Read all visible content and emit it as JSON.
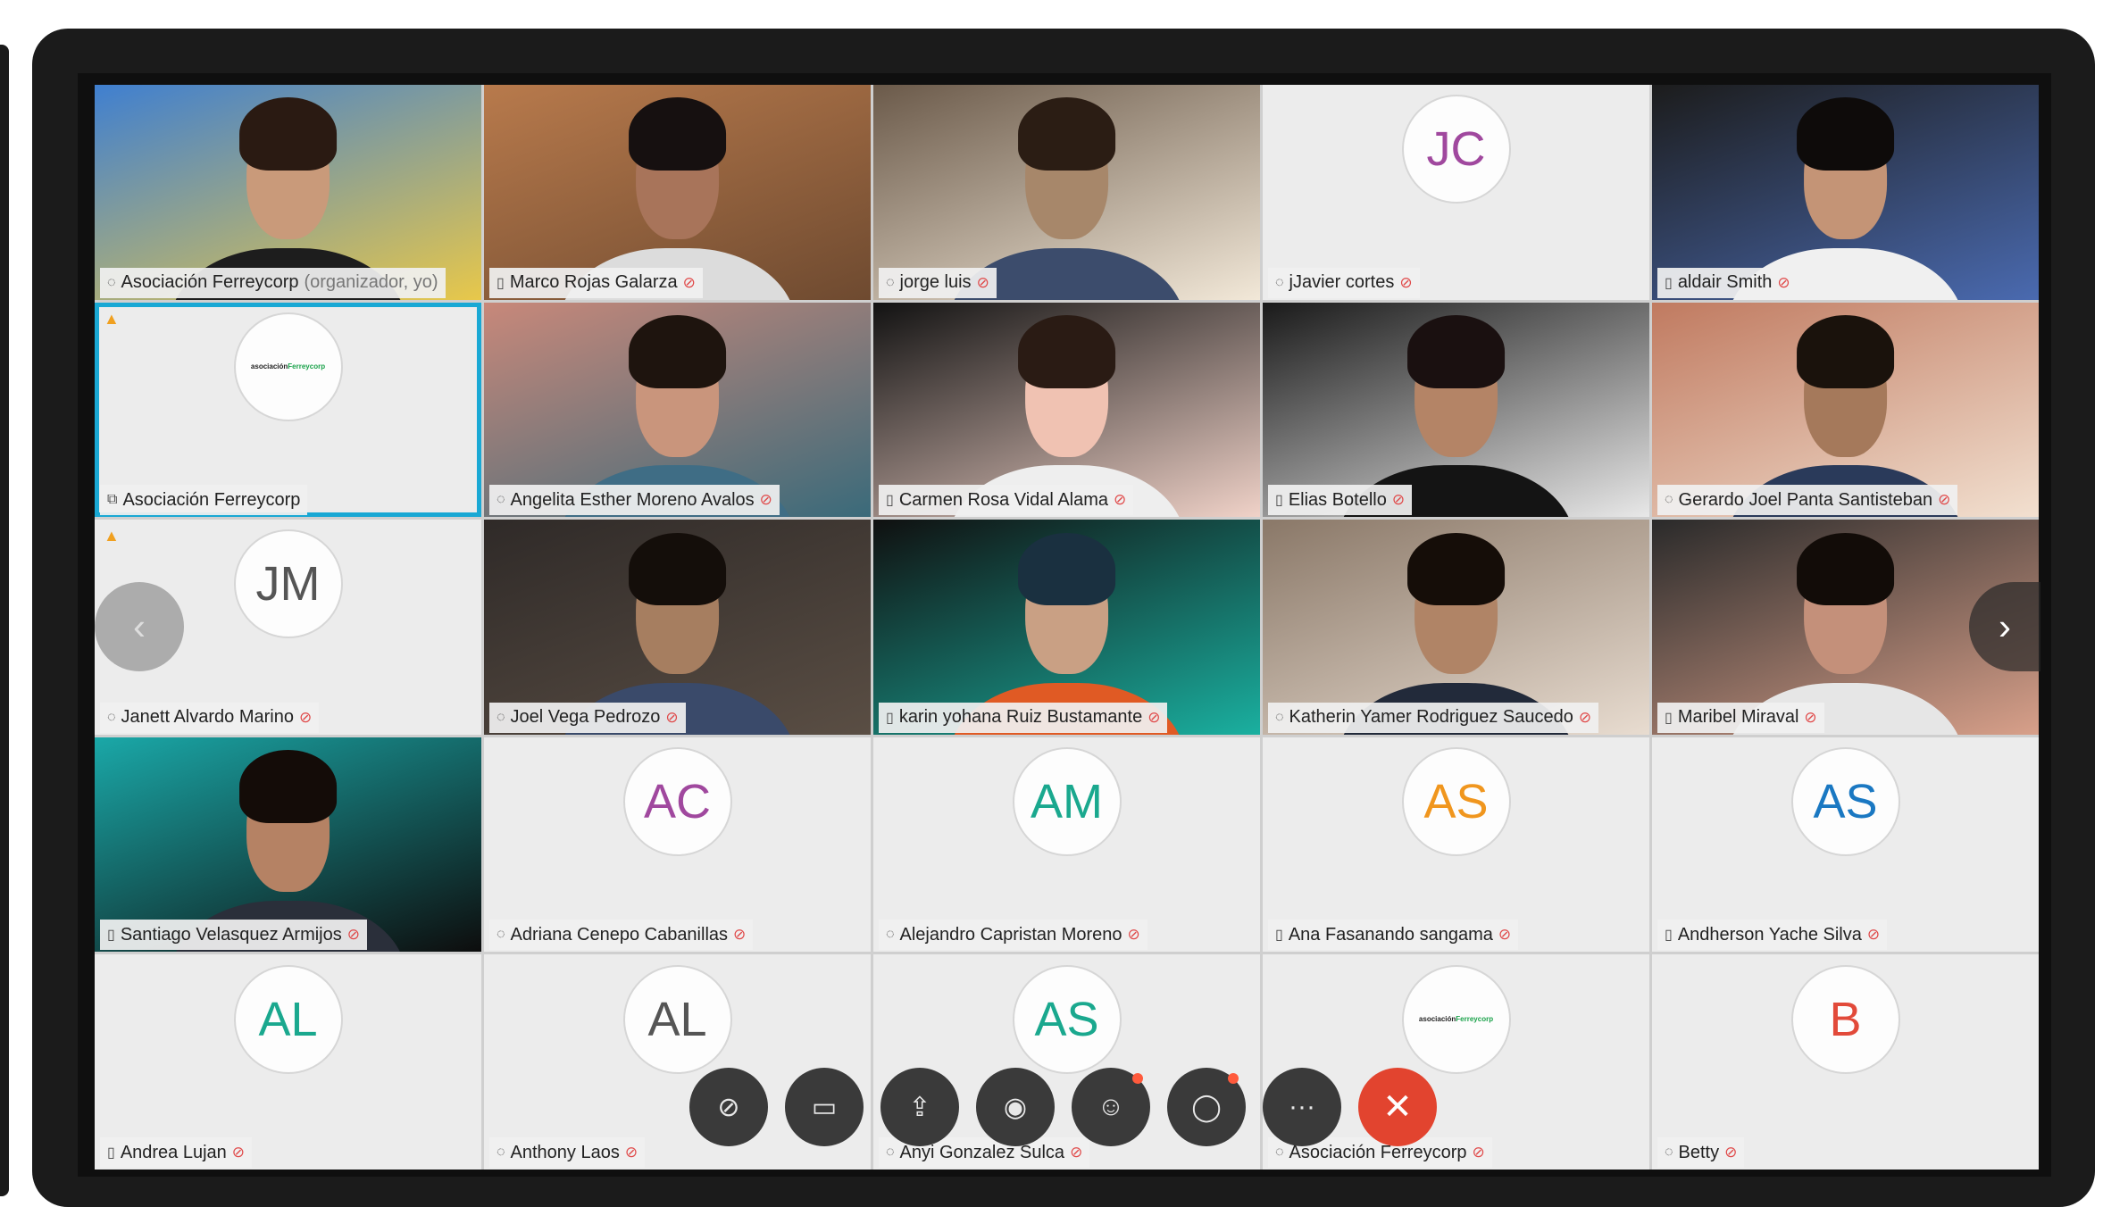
{
  "colors": {
    "selected_outline": "#19a8d4",
    "end_call": "#e2442f",
    "mic_off": "#e04848",
    "warning": "#f0a020"
  },
  "tiles": [
    {
      "name": "Asociación Ferreycorp",
      "role": "(organizador, yo)",
      "type": "video",
      "icon": "speaker-icon",
      "muted": false
    },
    {
      "name": "Marco Rojas Galarza",
      "type": "video",
      "icon": "phone-icon",
      "muted": true
    },
    {
      "name": "jorge luis",
      "type": "video",
      "icon": "speaker-icon",
      "muted": true
    },
    {
      "name": "jJavier cortes",
      "type": "avatar",
      "initials": "JC",
      "color": "#a0489e",
      "icon": "speaker-icon",
      "muted": true
    },
    {
      "name": "aldair Smith",
      "type": "video",
      "icon": "phone-icon",
      "muted": true
    },
    {
      "name": "Asociación Ferreycorp",
      "type": "logo",
      "logo_text_a": "asociación",
      "logo_text_b": "Ferreycorp",
      "icon": "share-icon",
      "muted": false,
      "selected": true,
      "warning": true
    },
    {
      "name": "Angelita Esther Moreno Avalos",
      "type": "video",
      "icon": "speaker-icon",
      "muted": true
    },
    {
      "name": "Carmen Rosa Vidal Alama",
      "type": "video",
      "icon": "phone-icon",
      "muted": true
    },
    {
      "name": "Elias Botello",
      "type": "video",
      "icon": "phone-icon",
      "muted": true
    },
    {
      "name": "Gerardo Joel Panta Santisteban",
      "type": "video",
      "icon": "speaker-icon",
      "muted": true
    },
    {
      "name": "Janett Alvardo Marino",
      "type": "avatar",
      "initials": "JM",
      "color": "#555555",
      "icon": "speaker-icon",
      "muted": true,
      "warning": true
    },
    {
      "name": "Joel Vega Pedrozo",
      "type": "video",
      "icon": "speaker-icon",
      "muted": true
    },
    {
      "name": "karin yohana Ruiz Bustamante",
      "type": "video",
      "icon": "phone-icon",
      "muted": true
    },
    {
      "name": "Katherin Yamer Rodriguez Saucedo",
      "type": "video",
      "icon": "speaker-icon",
      "muted": true
    },
    {
      "name": "Maribel Miraval",
      "type": "video",
      "icon": "phone-icon",
      "muted": true
    },
    {
      "name": "Santiago Velasquez Armijos",
      "type": "video",
      "icon": "phone-icon",
      "muted": true
    },
    {
      "name": "Adriana Cenepo Cabanillas",
      "type": "avatar",
      "initials": "AC",
      "color": "#a0489e",
      "icon": "speaker-icon",
      "muted": true
    },
    {
      "name": "Alejandro Capristan Moreno",
      "type": "avatar",
      "initials": "AM",
      "color": "#1aa88e",
      "icon": "speaker-icon",
      "muted": true
    },
    {
      "name": "Ana Fasanando sangama",
      "type": "avatar",
      "initials": "AS",
      "color": "#f0961e",
      "icon": "phone-icon",
      "muted": true
    },
    {
      "name": "Andherson Yache Silva",
      "type": "avatar",
      "initials": "AS",
      "color": "#1a78c2",
      "icon": "phone-icon",
      "muted": true
    },
    {
      "name": "Andrea Lujan",
      "type": "avatar",
      "initials": "AL",
      "color": "#1aa88e",
      "icon": "phone-icon",
      "muted": true
    },
    {
      "name": "Anthony Laos",
      "type": "avatar",
      "initials": "AL",
      "color": "#555555",
      "icon": "speaker-icon",
      "muted": true
    },
    {
      "name": "Anyi Gonzalez Sulca",
      "type": "avatar",
      "initials": "AS",
      "color": "#1aa88e",
      "icon": "speaker-icon",
      "muted": true
    },
    {
      "name": "Asociación Ferreycorp",
      "type": "logo",
      "logo_text_a": "asociación",
      "logo_text_b": "Ferreycorp",
      "icon": "speaker-icon",
      "muted": true
    },
    {
      "name": "Betty",
      "type": "avatar",
      "initials": "B",
      "color": "#e24a3a",
      "icon": "speaker-icon",
      "muted": true
    }
  ],
  "navigation": {
    "prev_icon": "chevron-left-icon",
    "next_icon": "chevron-right-icon"
  },
  "toolbar": [
    {
      "id": "mute",
      "icon": "mic-off-icon"
    },
    {
      "id": "video",
      "icon": "video-off-icon"
    },
    {
      "id": "share",
      "icon": "share-screen-icon"
    },
    {
      "id": "record",
      "icon": "record-icon"
    },
    {
      "id": "participants",
      "icon": "participants-icon",
      "notification": true
    },
    {
      "id": "chat",
      "icon": "chat-icon",
      "notification": true
    },
    {
      "id": "more",
      "icon": "more-icon"
    },
    {
      "id": "end",
      "icon": "end-call-icon"
    }
  ]
}
